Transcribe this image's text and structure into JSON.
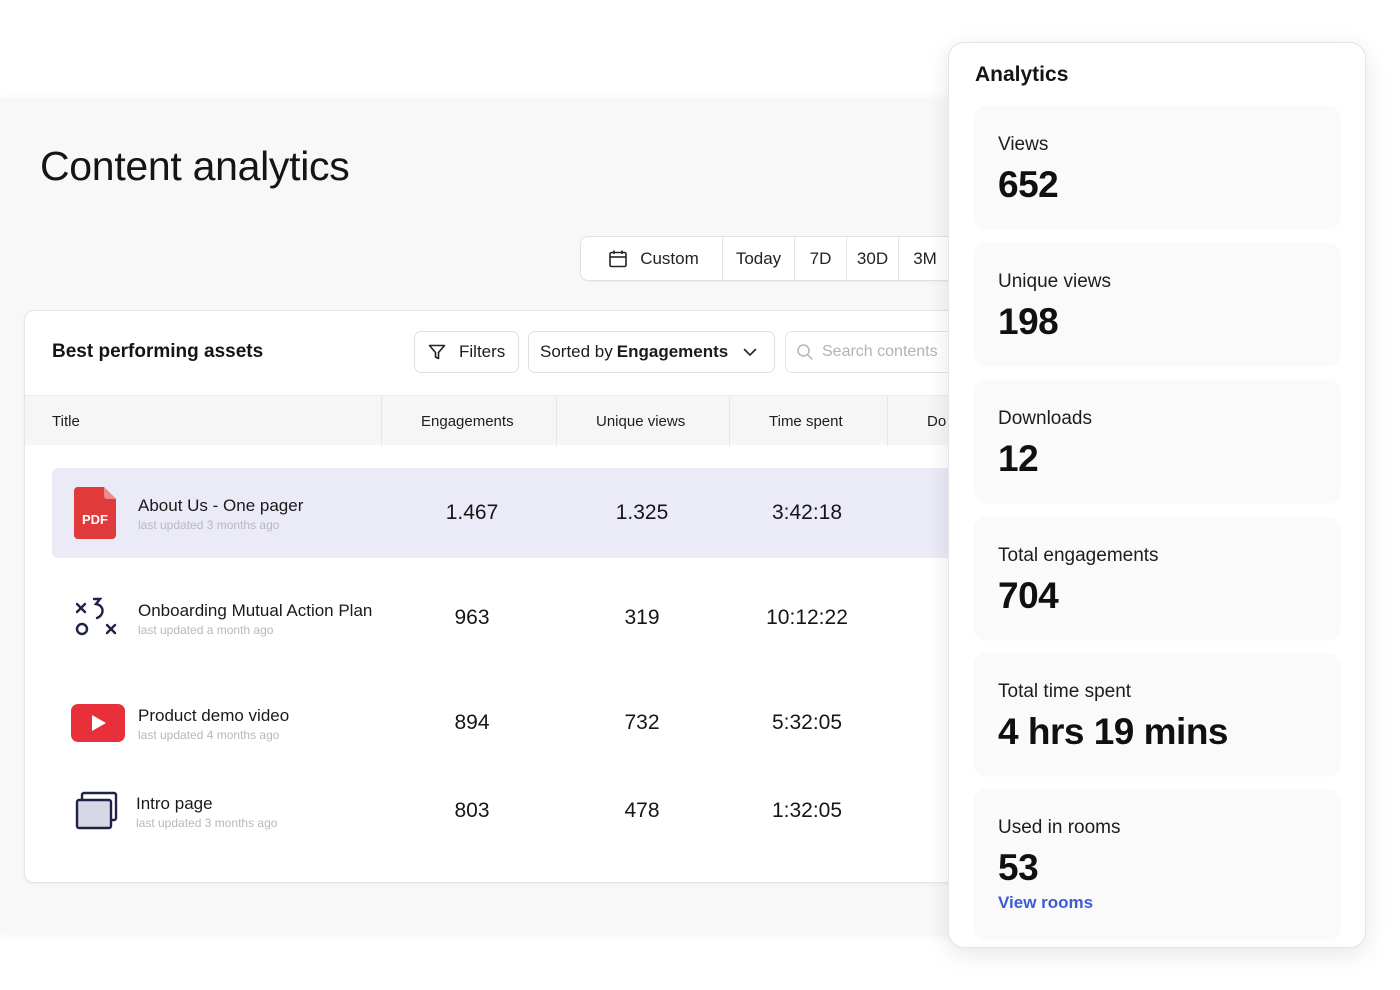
{
  "page": {
    "title": "Content analytics"
  },
  "date_range": {
    "custom_label": "Custom",
    "options": [
      "Today",
      "7D",
      "30D",
      "3M"
    ]
  },
  "assets": {
    "title": "Best performing assets",
    "filters_label": "Filters",
    "sort_prefix": "Sorted by",
    "sort_value": "Engagements",
    "search_placeholder": "Search contents",
    "columns": [
      "Title",
      "Engagements",
      "Unique views",
      "Time spent",
      "Do"
    ],
    "rows": [
      {
        "name": "About Us - One pager",
        "updated": "last updated 3 months ago",
        "engagements": "1.467",
        "unique_views": "1.325",
        "time_spent": "3:42:18",
        "icon": "pdf-icon",
        "icon_text": "PDF"
      },
      {
        "name": "Onboarding Mutual Action Plan",
        "updated": "last updated a month ago",
        "engagements": "963",
        "unique_views": "319",
        "time_spent": "10:12:22",
        "icon": "action-plan-icon"
      },
      {
        "name": "Product demo video",
        "updated": "last updated 4 months ago",
        "engagements": "894",
        "unique_views": "732",
        "time_spent": "5:32:05",
        "icon": "youtube-icon"
      },
      {
        "name": "Intro page",
        "updated": "last updated 3 months ago",
        "engagements": "803",
        "unique_views": "478",
        "time_spent": "1:32:05",
        "icon": "page-icon"
      }
    ]
  },
  "analytics": {
    "title": "Analytics",
    "stats": [
      {
        "label": "Views",
        "value": "652"
      },
      {
        "label": "Unique views",
        "value": "198"
      },
      {
        "label": "Downloads",
        "value": "12"
      },
      {
        "label": "Total engagements",
        "value": "704"
      },
      {
        "label": "Total time spent",
        "value": "4 hrs 19 mins"
      },
      {
        "label": "Used in rooms",
        "value": "53"
      }
    ],
    "view_rooms_label": "View rooms"
  },
  "colors": {
    "pdf_red": "#e03a3a",
    "youtube_red": "#e8303a",
    "selected_row": "#ebebf8",
    "link_blue": "#3d5bd9"
  }
}
